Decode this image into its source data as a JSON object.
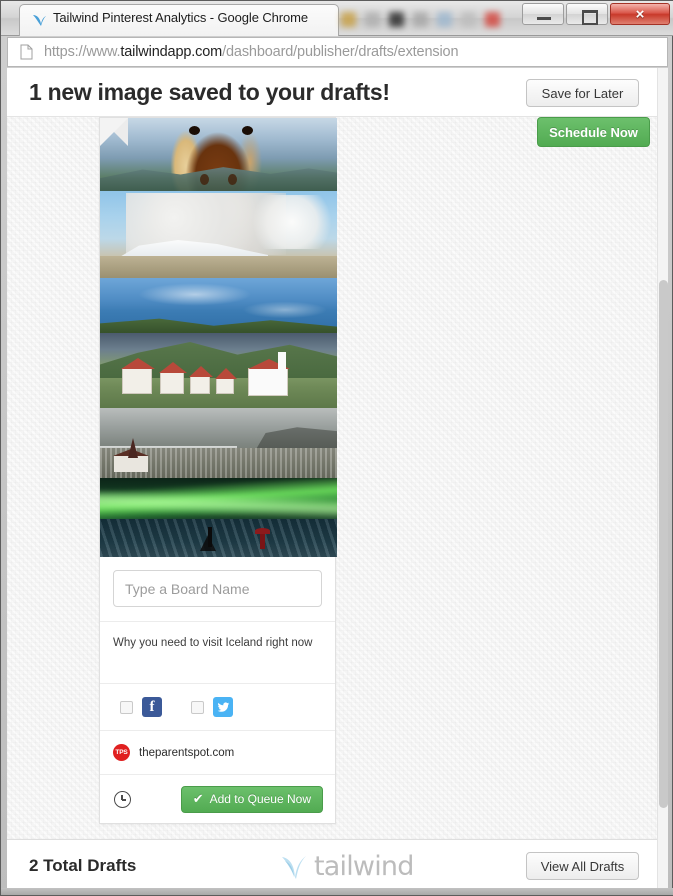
{
  "browser": {
    "tab_title": "Tailwind Pinterest Analytics - Google Chrome",
    "favicon_name": "tailwind-favicon",
    "url_scheme": "https://www.",
    "url_domain": "tailwindapp.com",
    "url_path": "/dashboard/publisher/drafts/extension",
    "window_controls": {
      "minimize": "–",
      "maximize": "□",
      "close": "×"
    }
  },
  "header": {
    "title": "1 new image saved to your drafts!",
    "save_for_later_label": "Save for Later",
    "schedule_now_label": "Schedule Now"
  },
  "card": {
    "images": [
      {
        "name": "icelandic-horse-photo",
        "alt": "Icelandic horse close-up on mountain ridge"
      },
      {
        "name": "volcano-ash-cloud-photo",
        "alt": "Volcanic ash plume over snowy mountain"
      },
      {
        "name": "mirror-lake-photo",
        "alt": "Mountain reflected in still blue lake"
      },
      {
        "name": "turf-houses-photo",
        "alt": "Traditional Icelandic turf houses and church"
      },
      {
        "name": "coastal-town-photo",
        "alt": "Aerial view of coastal town with cliffs"
      },
      {
        "name": "aurora-borealis-photo",
        "alt": "Northern lights over photographers on ice"
      }
    ],
    "board_placeholder": "Type a Board Name",
    "board_value": "",
    "description": "Why you need to visit Iceland right now",
    "social": {
      "facebook_label": "f",
      "facebook_checked": false,
      "twitter_checked": false
    },
    "source_favicon_text": "TPS",
    "source_domain": "theparentspot.com",
    "schedule_icon_name": "clock-icon",
    "queue_button_label": "Add to Queue Now",
    "queue_button_check": "✔"
  },
  "footer": {
    "total_drafts": "2 Total Drafts",
    "brand": "tailwind",
    "view_all_drafts_label": "View All Drafts"
  },
  "colors": {
    "green_accent": "#5cb85c",
    "facebook_blue": "#3b5998",
    "twitter_blue": "#4ab3f4",
    "favicon_red": "#e02020",
    "brand_grey": "#bcbcbc"
  }
}
